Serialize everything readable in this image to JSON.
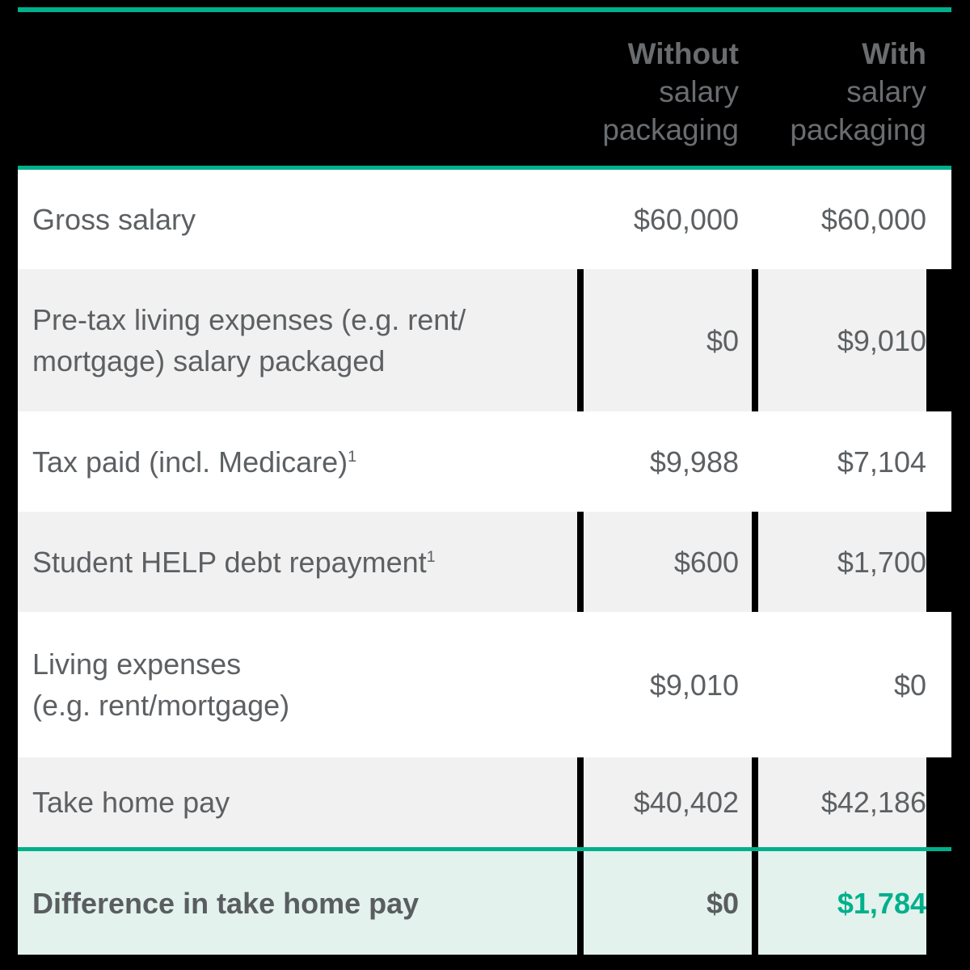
{
  "theme": {
    "background": "#000000",
    "accent_teal": "#00b08c",
    "text_grey": "#5d6063",
    "header_grey": "#6a6d70",
    "row_grey": "#f1f1f1",
    "row_white": "#ffffff",
    "total_row_bg": "#e3f2ec"
  },
  "header": {
    "label_column": "",
    "columns": [
      {
        "name": "without-salary-packaging",
        "lines": [
          "Without",
          "salary",
          "packaging"
        ]
      },
      {
        "name": "with-salary-packaging",
        "lines": [
          "With",
          "salary",
          "packaging"
        ]
      }
    ]
  },
  "rows": [
    {
      "name": "gross-salary",
      "label_lines": [
        "Gross salary"
      ],
      "footnote": "",
      "without": "$60,000",
      "with": "$60,000",
      "shade": "white",
      "emphasis": false
    },
    {
      "name": "pre-tax-living-expenses",
      "label_lines": [
        "Pre-tax living expenses (e.g. rent/",
        "mortgage) salary packaged"
      ],
      "footnote": "",
      "without": "$0",
      "with": "$9,010",
      "shade": "grey",
      "emphasis": false
    },
    {
      "name": "tax-paid",
      "label_lines": [
        "Tax paid (incl. Medicare)"
      ],
      "footnote": "1",
      "without": "$9,988",
      "with": "$7,104",
      "shade": "white",
      "emphasis": false
    },
    {
      "name": "student-help-debt-repayment",
      "label_lines": [
        "Student HELP debt repayment"
      ],
      "footnote": "1",
      "without": "$600",
      "with": "$1,700",
      "shade": "grey",
      "emphasis": false
    },
    {
      "name": "living-expenses",
      "label_lines": [
        "Living expenses",
        "(e.g. rent/mortgage)"
      ],
      "footnote": "",
      "without": "$9,010",
      "with": "$0",
      "shade": "white",
      "emphasis": false
    },
    {
      "name": "take-home-pay",
      "label_lines": [
        "Take home pay"
      ],
      "footnote": "",
      "without": "$40,402",
      "with": "$42,186",
      "shade": "grey",
      "emphasis": false
    }
  ],
  "total_row": {
    "name": "difference-in-take-home-pay",
    "label": "Difference in take home pay",
    "without": "$0",
    "with": "$1,784"
  }
}
